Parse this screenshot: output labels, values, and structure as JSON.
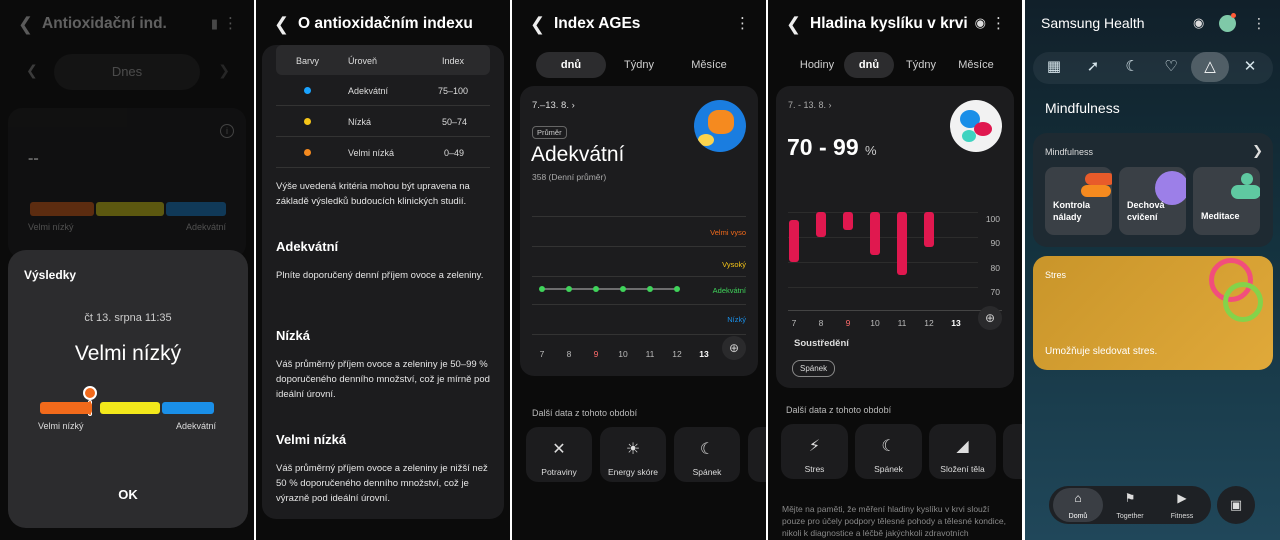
{
  "p1": {
    "title": "Antioxidační ind.",
    "date_tab": "Dnes",
    "value": "--",
    "scale_left": "Velmi nízký",
    "scale_right": "Adekvátní",
    "dialog": {
      "title": "Výsledky",
      "datetime": "čt 13. srpna 11:35",
      "result": "Velmi nízký",
      "left": "Velmi nízký",
      "right": "Adekvátní",
      "ok": "OK"
    }
  },
  "p2": {
    "title": "O antioxidačním indexu",
    "table": {
      "headers": [
        "Barvy",
        "Úroveň",
        "Index"
      ],
      "rows": [
        {
          "color": "#1aa3ff",
          "level": "Adekvátní",
          "index": "75–100"
        },
        {
          "color": "#f5c518",
          "level": "Nízká",
          "index": "50–74"
        },
        {
          "color": "#f58a1f",
          "level": "Velmi nízká",
          "index": "0–49"
        }
      ]
    },
    "intro": "Výše uvedená kritéria mohou být upravena na základě výsledků budoucích klinických studií.",
    "sections": [
      {
        "heading": "Adekvátní",
        "text": "Plníte doporučený denní příjem ovoce a zeleniny."
      },
      {
        "heading": "Nízká",
        "text": "Váš průměrný příjem ovoce a zeleniny je 50–99 % doporučeného denního množství, což je mírně pod ideální úrovní."
      },
      {
        "heading": "Velmi nízká",
        "text": "Váš průměrný příjem ovoce a zeleniny je nižší než 50 % doporučeného denního množství, což je výrazně pod ideální úrovní."
      }
    ]
  },
  "p3": {
    "title": "Index AGEs",
    "tabs": [
      "dnů",
      "Týdny",
      "Měsíce"
    ],
    "range": "7.–13. 8.",
    "badge": "Průměr",
    "level": "Adekvátní",
    "avg": "358 (Denní průměr)",
    "bands": [
      "Velmi vyso",
      "Vysoký",
      "Adekvátní",
      "Nízký"
    ],
    "days": [
      "7",
      "8",
      "9",
      "10",
      "11",
      "12",
      "13"
    ],
    "more_title": "Další data z tohoto období",
    "tiles": [
      {
        "icon": "fork-knife-icon",
        "label": "Potraviny"
      },
      {
        "icon": "energy-icon",
        "label": "Energy skóre"
      },
      {
        "icon": "moon-icon",
        "label": "Spánek"
      }
    ]
  },
  "p4": {
    "title": "Hladina kyslíku v krvi",
    "tabs": [
      "Hodiny",
      "dnů",
      "Týdny",
      "Měsíce"
    ],
    "range": "7. - 13. 8.",
    "value": "70 - 99",
    "unit": "%",
    "yticks": [
      "100",
      "90",
      "80",
      "70"
    ],
    "days": [
      "7",
      "8",
      "9",
      "10",
      "11",
      "12",
      "13"
    ],
    "section": "Soustředění",
    "chip": "Spánek",
    "more_title": "Další data z tohoto období",
    "tiles": [
      {
        "icon": "stress-icon",
        "label": "Stres"
      },
      {
        "icon": "moon-icon",
        "label": "Spánek"
      },
      {
        "icon": "body-icon",
        "label": "Složení těla"
      }
    ],
    "footer": "Mějte na paměti, že měření hladiny kyslíku v krvi slouží pouze pro účely podpory tělesné pohody a tělesné kondice, nikoli k diagnostice a léčbě jakýchkoli zdravotních"
  },
  "p5": {
    "app": "Samsung Health",
    "section": "Mindfulness",
    "card_title": "Mindfulness",
    "tiles": [
      "Kontrola nálady",
      "Dechová cvičení",
      "Meditace"
    ],
    "stress_title": "Stres",
    "stress_text": "Umožňuje sledovat stres.",
    "nav": [
      "Domů",
      "Together",
      "Fitness"
    ]
  },
  "chart_data": [
    {
      "type": "line",
      "title": "Index AGEs",
      "categories": [
        "7",
        "8",
        "9",
        "10",
        "11",
        "12",
        "13"
      ],
      "series": [
        {
          "values": [
            2,
            2,
            2,
            2,
            2,
            2,
            2.1
          ]
        }
      ]
    },
    {
      "type": "bar",
      "title": "Hladina kyslíku v krvi",
      "categories": [
        "7",
        "8",
        "9",
        "10",
        "11",
        "12",
        "13"
      ],
      "ylim": [
        70,
        100
      ],
      "series": [
        {
          "lows": [
            80,
            90,
            93,
            83,
            75,
            86
          ],
          "highs": [
            97,
            100,
            100,
            100,
            100,
            100
          ]
        }
      ]
    }
  ]
}
